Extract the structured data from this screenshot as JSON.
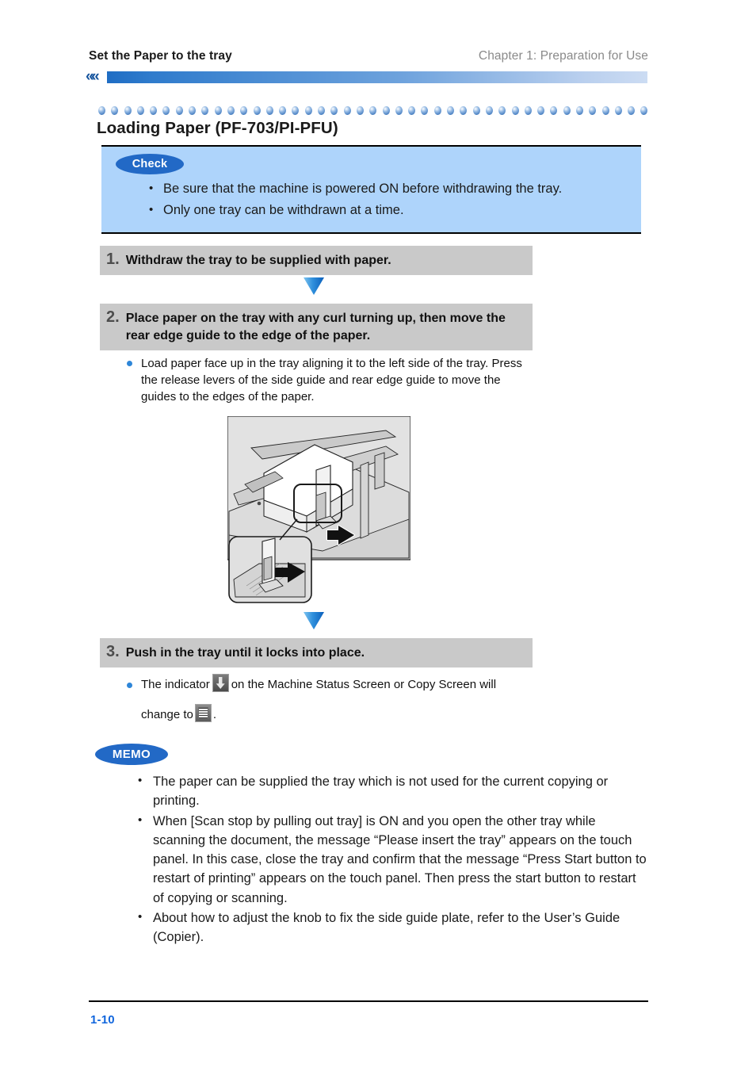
{
  "header": {
    "left_title": "Set the Paper to the tray",
    "right_title": "Chapter 1: Preparation for Use",
    "chevron_icon": "««"
  },
  "section": {
    "title": "Loading Paper (PF-703/PI-PFU)"
  },
  "check_callout": {
    "badge_label": "Check",
    "items": [
      "Be sure that the machine is powered ON before withdrawing the tray.",
      "Only one tray can be withdrawn at a time."
    ]
  },
  "steps": [
    {
      "number": "1.",
      "text": "Withdraw the tray to be supplied with paper."
    },
    {
      "number": "2.",
      "text": "Place paper on the tray with any curl turning up, then move the rear edge guide to the edge of the paper."
    },
    {
      "number": "3.",
      "text": "Push in the tray until it locks into place."
    }
  ],
  "step2_note": "Load paper face up in the tray aligning it to the left side of the tray. Press the release levers of the side guide and rear edge guide to move the guides to the edges of the paper.",
  "step3_note": {
    "part1": "The indicator",
    "part2": "on the Machine Status Screen or Copy Screen will",
    "part3": "change to",
    "part4": ".",
    "icon1_name": "tray-empty-indicator-icon",
    "icon2_name": "tray-loaded-indicator-icon"
  },
  "illustration": {
    "caption": "paper-tray-loading-illustration"
  },
  "memo_callout": {
    "badge_label": "MEMO",
    "items": [
      "The paper can be supplied the tray which is not used for the current copying or printing.",
      "When [Scan stop by pulling out tray] is ON and you open the other tray while scanning the document, the message “Please insert the tray” appears on the touch panel. In this case, close the tray and confirm that the message “Press Start button to restart of printing” appears on the touch panel. Then press the start button to restart of copying or scanning.",
      "About how to adjust the knob to fix the side guide plate, refer to the User’s Guide (Copier)."
    ]
  },
  "footer": {
    "page_number": "1-10"
  },
  "colors": {
    "accent_blue": "#2269c6",
    "band_blue": "#2f7bcc",
    "callout_bg": "#aed4fb",
    "step_bar_gray": "#c9c9c9",
    "page_number_blue": "#1166dd"
  }
}
